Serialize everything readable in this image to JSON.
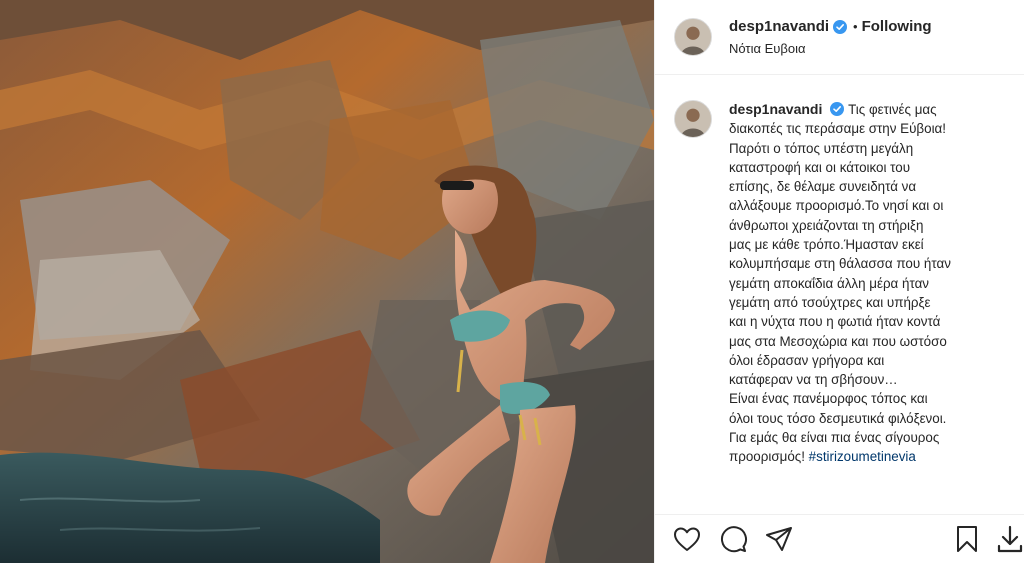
{
  "post": {
    "username": "desp1navandi",
    "follow_separator": "•",
    "follow_status": "Following",
    "location": "Νότια Ευβοια"
  },
  "caption": {
    "username": "desp1navandi",
    "text": "Τις φετινές μας\nδιακοπές τις περάσαμε στην Εύβοια!\nΠαρότι ο τόπος υπέστη μεγάλη\nκαταστροφή και οι κάτοικοι του\nεπίσης, δε θέλαμε συνειδητά να\nαλλάξουμε προορισμό.Το νησί και οι\nάνθρωποι χρειάζονται τη στήριξη\nμας με κάθε τρόπο.Ήμασταν εκεί\nκολυμπήσαμε στη θάλασσα που ήταν\nγεμάτη αποκαΐδια άλλη μέρα ήταν\nγεμάτη από τσούχτρες και υπήρξε\nκαι η νύχτα που η φωτιά ήταν κοντά\nμας στα Μεσοχώρια και που ωστόσο\nόλοι έδρασαν γρήγορα και\nκατάφεραν να τη σβήσουν…\nΕίναι ένας πανέμορφος τόπος και\nόλοι τους τόσο δεσμευτικά φιλόξενοι.\nΓια εμάς θα είναι πια ένας σίγουρος\nπροορισμός! ",
    "hashtag": "#stirizoumetinevia"
  },
  "icons": {
    "verified": "verified-badge-icon",
    "like": "heart-icon",
    "comment": "comment-icon",
    "share": "paper-plane-icon",
    "save": "bookmark-icon",
    "download": "download-icon"
  },
  "colors": {
    "verified": "#3897f0",
    "hashtag": "#00376b",
    "text": "#262626",
    "border": "#efefef"
  }
}
